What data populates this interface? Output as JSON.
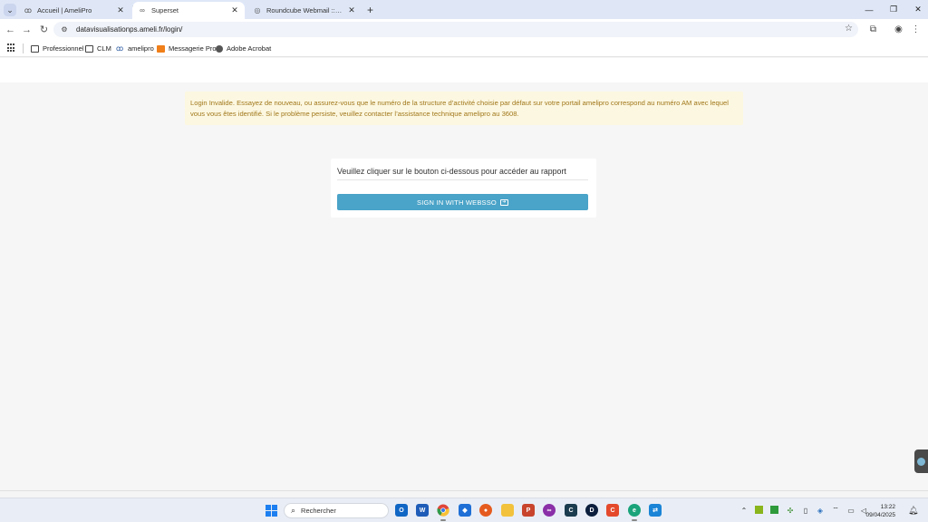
{
  "browser": {
    "tabs": [
      {
        "title": "Accueil | AmeliPro",
        "icon": "ameli-favicon",
        "active": false
      },
      {
        "title": "Superset",
        "icon": "superset-favicon",
        "active": true
      },
      {
        "title": "Roundcube Webmail :: Boîte de",
        "icon": "roundcube-favicon",
        "active": false
      }
    ],
    "new_tab_label": "+",
    "url": "datavisualisationps.ameli.fr/login/",
    "bookmarks": [
      {
        "label": "Professionnel",
        "icon": "folder-icon"
      },
      {
        "label": "CLM",
        "icon": "folder-icon"
      },
      {
        "label": "amelipro",
        "icon": "ameli-icon"
      },
      {
        "label": "Messagerie Pro",
        "icon": "orange-icon"
      },
      {
        "label": "Adobe Acrobat",
        "icon": "acrobat-icon"
      }
    ]
  },
  "page": {
    "alert_text": "Login Invalide. Essayez de nouveau, ou assurez-vous que le numéro de la structure d’activité choisie par défaut sur votre portail amelipro correspond au numéro AM avec lequel vous vous êtes identifié. Si le problème persiste, veuillez contacter l’assistance technique amelipro au 3608.",
    "alert_color": "#fcf7e0",
    "login_prompt": "Veuillez cliquer sur le bouton ci-dessous pour accéder au rapport",
    "sso_button_label": "SIGN IN WITH WEBSSO",
    "accent_color": "#4aa3c8"
  },
  "taskbar": {
    "search_placeholder": "Rechercher",
    "apps": [
      "outlook",
      "word",
      "chrome",
      "defender",
      "firefox",
      "file-explorer",
      "powerpoint",
      "app-purple",
      "terminal",
      "dashlane",
      "app-red",
      "edge",
      "teamviewer"
    ],
    "time": "13:22",
    "date": "09/04/2025"
  }
}
